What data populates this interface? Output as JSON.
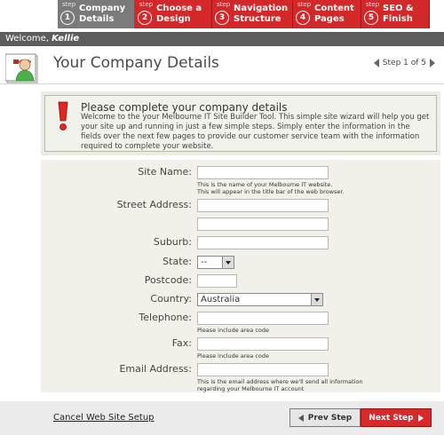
{
  "steps": [
    {
      "step_word": "step",
      "num": "1",
      "label": "Company\nDetails",
      "active": true
    },
    {
      "step_word": "step",
      "num": "2",
      "label": "Choose a\nDesign",
      "active": false
    },
    {
      "step_word": "step",
      "num": "3",
      "label": "Navigation\nStructure",
      "active": false
    },
    {
      "step_word": "step",
      "num": "4",
      "label": "Content\nPages",
      "active": false
    },
    {
      "step_word": "step",
      "num": "5",
      "label": "SEO &\nFinish",
      "active": false
    }
  ],
  "welcome": {
    "prefix": "Welcome, ",
    "name": "Kellie"
  },
  "header": {
    "title": "Your Company Details",
    "step_indicator": "Step 1 of 5"
  },
  "notice": {
    "title": "Please complete your company details",
    "text": "Welcome to the your Melbourne IT Site Builder Tool. This simple site wizard will help you get your site up and running in just a few simple steps. Simply enter the information in the fields over the next few pages to provide our customer service team with the information required to complete your website."
  },
  "form": {
    "site_name": {
      "label": "Site Name:",
      "value": "",
      "hint1": "This is the name of your Melbourne IT website.",
      "hint2": "This will appear in the title bar of the web browser."
    },
    "street_address": {
      "label": "Street Address:",
      "value": "",
      "value2": ""
    },
    "suburb": {
      "label": "Suburb:",
      "value": ""
    },
    "state": {
      "label": "State:",
      "selected": "--"
    },
    "postcode": {
      "label": "Postcode:",
      "value": ""
    },
    "country": {
      "label": "Country:",
      "selected": "Australia"
    },
    "telephone": {
      "label": "Telephone:",
      "value": "",
      "hint": "Please include area code"
    },
    "fax": {
      "label": "Fax:",
      "value": "",
      "hint": "Please include area code"
    },
    "email": {
      "label": "Email Address:",
      "value": "",
      "hint1": "This is the email address where we'll send all information",
      "hint2": "regarding your Melbourne IT account"
    }
  },
  "footer": {
    "cancel": "Cancel Web Site Setup",
    "prev": "Prev Step",
    "next": "Next Step"
  },
  "colors": {
    "accent_red": "#d2282a",
    "active_step_gray": "#7a7a7a",
    "welcome_bar": "#5d5d5d",
    "panel_bg": "#f1f1e9"
  },
  "icons": {
    "avatar": "user-avatar-icon",
    "warning": "exclamation-icon",
    "prev": "left-triangle-icon",
    "next": "right-triangle-icon"
  }
}
